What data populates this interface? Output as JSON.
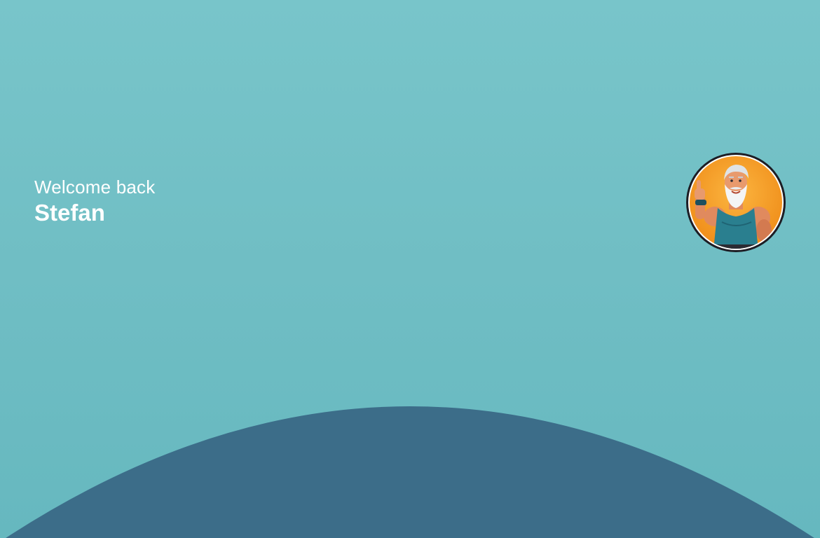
{
  "greeting": {
    "welcome_text": "Welcome back",
    "user_name": "Stefan"
  },
  "avatar": {
    "icon": "profile-avatar-muscular-old-man-thumbs-up",
    "ring_color": "#1d1d24",
    "background_color": "#f7a22a",
    "shirt_color": "#2a7f8f"
  },
  "colors": {
    "background_top": "#78c5ca",
    "background_bottom": "#66b8bf",
    "arc": "#3c6d89",
    "text": "#ffffff"
  }
}
